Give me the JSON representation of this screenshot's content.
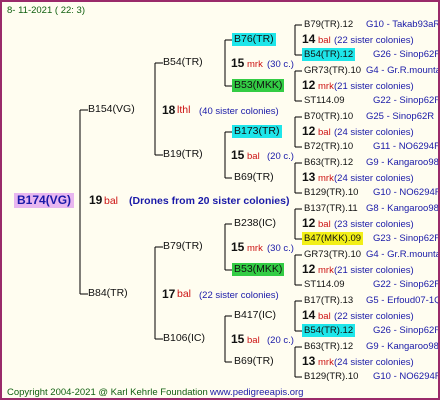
{
  "header": {
    "date": "8- 11-2021 ( 22: 3)"
  },
  "footer": {
    "copyright": "Copyright 2004-2021 @ Karl Kehrle Foundation",
    "website": "www.pedigreeapis.org"
  },
  "colors": {
    "cyan": "#1ee6ea",
    "green": "#33cc44",
    "yellow": "#f2ef18",
    "magenta": "#e8b6f0"
  },
  "root": {
    "id": "B174(VG)",
    "year": "19",
    "mark": "bal",
    "note": "(Drones from 20 sister colonies)"
  },
  "gen1": [
    {
      "id": "B154(VG)",
      "year": "18",
      "mark": "lthl",
      "note": "(40 sister colonies)"
    },
    {
      "id": "B84(TR)",
      "year": "17",
      "mark": "bal",
      "note": "(22 sister colonies)"
    }
  ],
  "gen2": [
    {
      "id": "B54(TR)",
      "year": "15",
      "mark": "mrk",
      "note": "(30 c.)"
    },
    {
      "id": "B19(TR)",
      "year": "15",
      "mark": "bal",
      "note": "(20 c.)"
    },
    {
      "id": "B79(TR)",
      "year": "15",
      "mark": "mrk",
      "note": "(30 c.)"
    },
    {
      "id": "B106(IC)",
      "year": "15",
      "mark": "bal",
      "note": "(20 c.)"
    }
  ],
  "gen3": [
    {
      "id": "B76(TR)",
      "hl": "cyan"
    },
    {
      "id": "B53(MKK)",
      "hl": "green"
    },
    {
      "id": "B173(TR)",
      "hl": "cyan"
    },
    {
      "id": "B69(TR)",
      "hl": ""
    },
    {
      "id": "B238(IC)",
      "hl": ""
    },
    {
      "id": "B53(MKK)",
      "hl": "green"
    },
    {
      "id": "B417(IC)",
      "hl": ""
    },
    {
      "id": "B69(TR)",
      "hl": ""
    }
  ],
  "gen4": [
    {
      "sire": "B79(TR).12",
      "sire_hl": "",
      "sire_code": "G10 - Takab93aR",
      "year": "14",
      "mark": "bal",
      "note": "(22 sister colonies)",
      "dam": "B54(TR).12",
      "dam_hl": "cyan",
      "dam_code": "G26 - Sinop62R"
    },
    {
      "sire": "GR73(TR).10",
      "sire_hl": "",
      "sire_code": "G4 - Gr.R.mounta",
      "year": "12",
      "mark": "mrk",
      "note": "(21 sister colonies)",
      "dam": "ST114.09",
      "dam_hl": "",
      "dam_code": "G22 - Sinop62R"
    },
    {
      "sire": "B70(TR).10",
      "sire_hl": "",
      "sire_code": "G25 - Sinop62R",
      "year": "12",
      "mark": "bal",
      "note": "(24 sister colonies)",
      "dam": "B72(TR).10",
      "dam_hl": "",
      "dam_code": "G11 - NO6294R"
    },
    {
      "sire": "B63(TR).12",
      "sire_hl": "",
      "sire_code": "G9 - Kangaroo98R",
      "year": "13",
      "mark": "mrk",
      "note": "(24 sister colonies)",
      "dam": "B129(TR).10",
      "dam_hl": "",
      "dam_code": "G10 - NO6294R"
    },
    {
      "sire": "B137(TR).11",
      "sire_hl": "",
      "sire_code": "G8 - Kangaroo98R",
      "year": "12",
      "mark": "bal",
      "note": "(23 sister colonies)",
      "dam": "B47(MKK).09",
      "dam_hl": "yellow",
      "dam_code": "G23 - Sinop62R"
    },
    {
      "sire": "GR73(TR).10",
      "sire_hl": "",
      "sire_code": "G4 - Gr.R.mounta",
      "year": "12",
      "mark": "mrk",
      "note": "(21 sister colonies)",
      "dam": "ST114.09",
      "dam_hl": "",
      "dam_code": "G22 - Sinop62R"
    },
    {
      "sire": "B17(TR).13",
      "sire_hl": "",
      "sire_code": "G5 - Erfoud07-1Q",
      "year": "14",
      "mark": "bal",
      "note": "(22 sister colonies)",
      "dam": "B54(TR).12",
      "dam_hl": "cyan",
      "dam_code": "G26 - Sinop62R"
    },
    {
      "sire": "B63(TR).12",
      "sire_hl": "",
      "sire_code": "G9 - Kangaroo98R",
      "year": "13",
      "mark": "mrk",
      "note": "(24 sister colonies)",
      "dam": "B129(TR).10",
      "dam_hl": "",
      "dam_code": "G10 - NO6294R"
    }
  ]
}
